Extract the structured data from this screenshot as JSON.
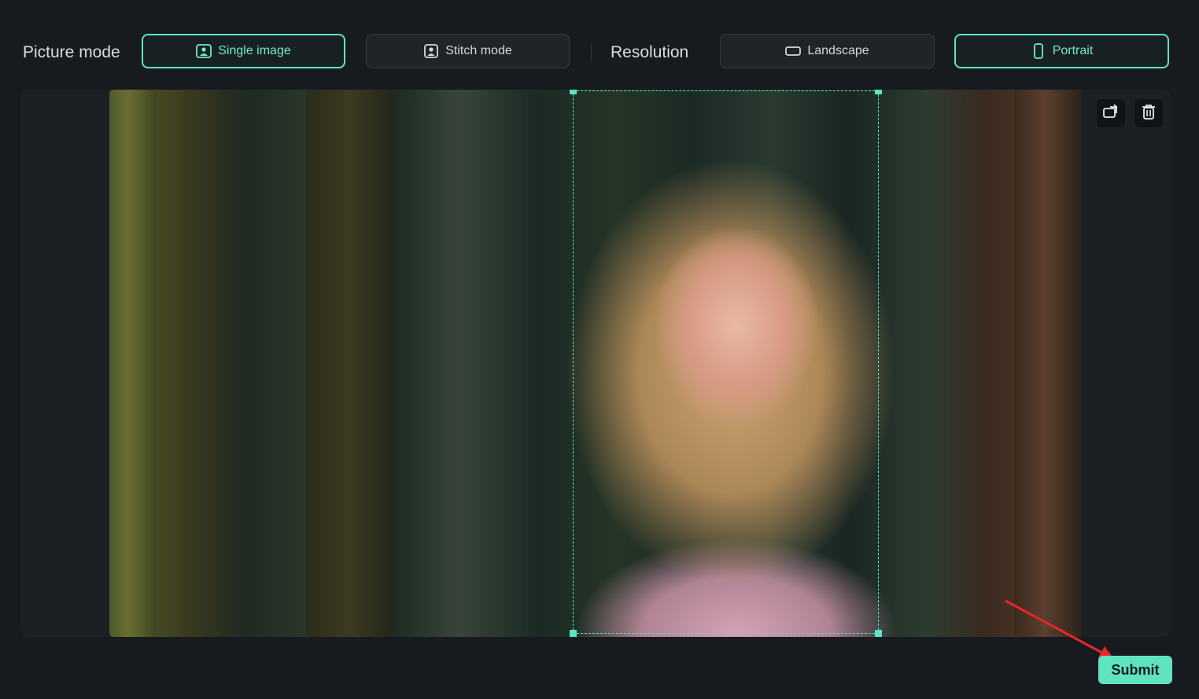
{
  "picture_mode": {
    "label": "Picture mode",
    "options": [
      {
        "label": "Single image",
        "icon": "image-portrait-icon",
        "selected": true
      },
      {
        "label": "Stitch mode",
        "icon": "portrait-stack-icon",
        "selected": false
      }
    ]
  },
  "resolution": {
    "label": "Resolution",
    "options": [
      {
        "label": "Landscape",
        "icon": "landscape-rect-icon",
        "selected": false
      },
      {
        "label": "Portrait",
        "icon": "portrait-rect-icon",
        "selected": true
      }
    ]
  },
  "canvas": {
    "tools": [
      {
        "name": "replace-image-icon"
      },
      {
        "name": "trash-icon"
      }
    ]
  },
  "actions": {
    "submit_label": "Submit"
  },
  "colors": {
    "accent": "#5fe3c1",
    "background": "#171b1f",
    "annotation_arrow": "#e5262a"
  }
}
